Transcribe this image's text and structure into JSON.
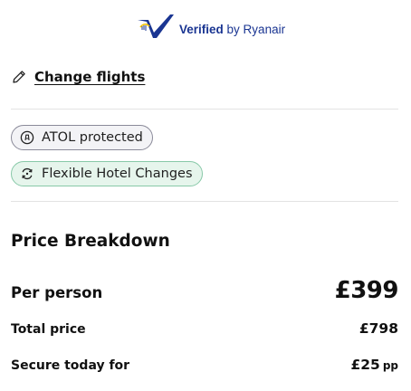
{
  "verified": {
    "bold": "Verified",
    "rest": "by Ryanair",
    "color": "#1a3592",
    "icon": "ryanair-harp-check-icon"
  },
  "change_flights": {
    "icon": "pencil-icon",
    "label": "Change flights"
  },
  "chips": [
    {
      "icon": "atol-icon",
      "label": "ATOL protected",
      "border": "#8a8a99",
      "background": "#f3f3f6"
    },
    {
      "icon": "swap-cycle-icon",
      "label": "Flexible Hotel Changes",
      "border": "#88c9a8",
      "background": "#e6f5ec"
    }
  ],
  "price_breakdown": {
    "title": "Price Breakdown",
    "per_person": {
      "label": "Per person",
      "value": "£399"
    },
    "total": {
      "label": "Total price",
      "value": "£798"
    },
    "secure": {
      "label": "Secure today for",
      "value": "£25",
      "suffix": "pp"
    }
  }
}
